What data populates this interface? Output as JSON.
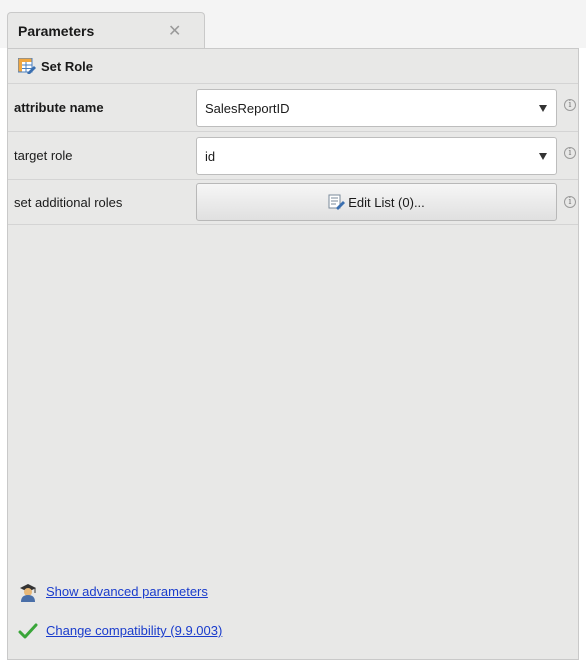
{
  "tab": {
    "label": "Parameters",
    "close_glyph": "✕"
  },
  "operator": {
    "title": "Set Role",
    "icon": "set-role-icon"
  },
  "params": [
    {
      "label": "attribute name",
      "value": "SalesReportID",
      "required": true
    },
    {
      "label": "target role",
      "value": "id",
      "required": false
    },
    {
      "label": "set additional roles",
      "button_label": "Edit List (0)...",
      "required": false
    }
  ],
  "info_glyph": "i",
  "footer": {
    "advanced_label": "Show advanced parameters",
    "compat_label": "Change compatibility (9.9.003)"
  },
  "colors": {
    "link": "#1a3ccc",
    "check": "#3aa63a",
    "panel_bg": "#e8e8e7"
  }
}
